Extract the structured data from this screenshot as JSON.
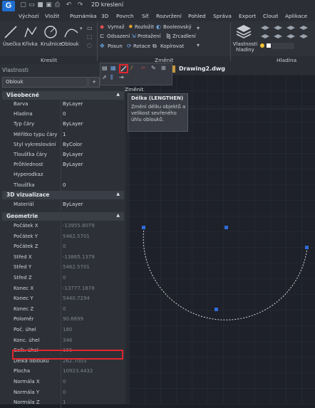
{
  "titlebar": {
    "logo": "G",
    "workspace": "2D kreslení"
  },
  "menu": [
    "Výchozí",
    "Vložit",
    "Poznámka",
    "3D",
    "Povrch",
    "Síť",
    "Rozvržení",
    "Pohled",
    "Správa",
    "Export",
    "Cloud",
    "Aplikace"
  ],
  "ribbon": {
    "draw_tools": [
      "Úsečka",
      "Křivka",
      "Kružnice",
      "Oblouk"
    ],
    "modify_tools": {
      "row1": [
        "Vymaž",
        "Rozložit",
        "Booleovský"
      ],
      "row2": [
        "Odsazení",
        "Protažení",
        "Zrcadlení"
      ],
      "row3": [
        "Posun",
        "Rotace",
        "Kopírovat"
      ]
    },
    "layer_props": "Vlastnosti hladiny",
    "panels": {
      "draw": "Kreslit",
      "modify": "Změnit",
      "layer": "Hladina"
    },
    "floating_title": "Změnit"
  },
  "tooltip": {
    "title": "Délka (LENGTHEN)",
    "description": "Změní délku objektů a velikost sevřeného úhlu oblouků."
  },
  "drawing_tab": "Drawing2.dwg",
  "properties": {
    "title": "Vlastnosti",
    "object_type": "Oblouk",
    "sections": {
      "general": "Všeobecné",
      "viz3d": "3D vizualizace",
      "geometry": "Geometrie"
    },
    "general": [
      {
        "k": "Barva",
        "v": "ByLayer"
      },
      {
        "k": "Hladina",
        "v": "0"
      },
      {
        "k": "Typ čáry",
        "v": "ByLayer"
      },
      {
        "k": "Měřítko typu čáry",
        "v": "1"
      },
      {
        "k": "Styl vykreslování",
        "v": "ByColor"
      },
      {
        "k": "Tloušťka čáry",
        "v": "ByLayer"
      },
      {
        "k": "Průhlednost",
        "v": "ByLayer"
      },
      {
        "k": "Hyperodkaz",
        "v": ""
      },
      {
        "k": "Tloušťka",
        "v": "0"
      }
    ],
    "viz3d": [
      {
        "k": "Materiál",
        "v": "ByLayer"
      }
    ],
    "geometry": [
      {
        "k": "Počátek X",
        "v": "-13955.8079"
      },
      {
        "k": "Počátek Y",
        "v": "5462.5701"
      },
      {
        "k": "Počátek Z",
        "v": "0"
      },
      {
        "k": "Střed X",
        "v": "-13865.1379"
      },
      {
        "k": "Střed Y",
        "v": "5462.5701"
      },
      {
        "k": "Střed Z",
        "v": "0"
      },
      {
        "k": "Konec X",
        "v": "-13777.1878"
      },
      {
        "k": "Konec Y",
        "v": "5440.7294"
      },
      {
        "k": "Konec Z",
        "v": "0"
      },
      {
        "k": "Poloměr",
        "v": "90.6699"
      },
      {
        "k": "Poč. úhel",
        "v": "180"
      },
      {
        "k": "Konc. úhel",
        "v": "346"
      },
      {
        "k": "Celk. úhel",
        "v": "166"
      },
      {
        "k": "Délka oblouku",
        "v": "262.7003"
      },
      {
        "k": "Plocha",
        "v": "10923.4432"
      },
      {
        "k": "Normála X",
        "v": "0"
      },
      {
        "k": "Normála Y",
        "v": "0"
      },
      {
        "k": "Normála Z",
        "v": "1"
      }
    ]
  },
  "colors": {
    "highlight": "#e0262f",
    "accent": "#1f6fd1",
    "grip": "#2f6bd8"
  }
}
